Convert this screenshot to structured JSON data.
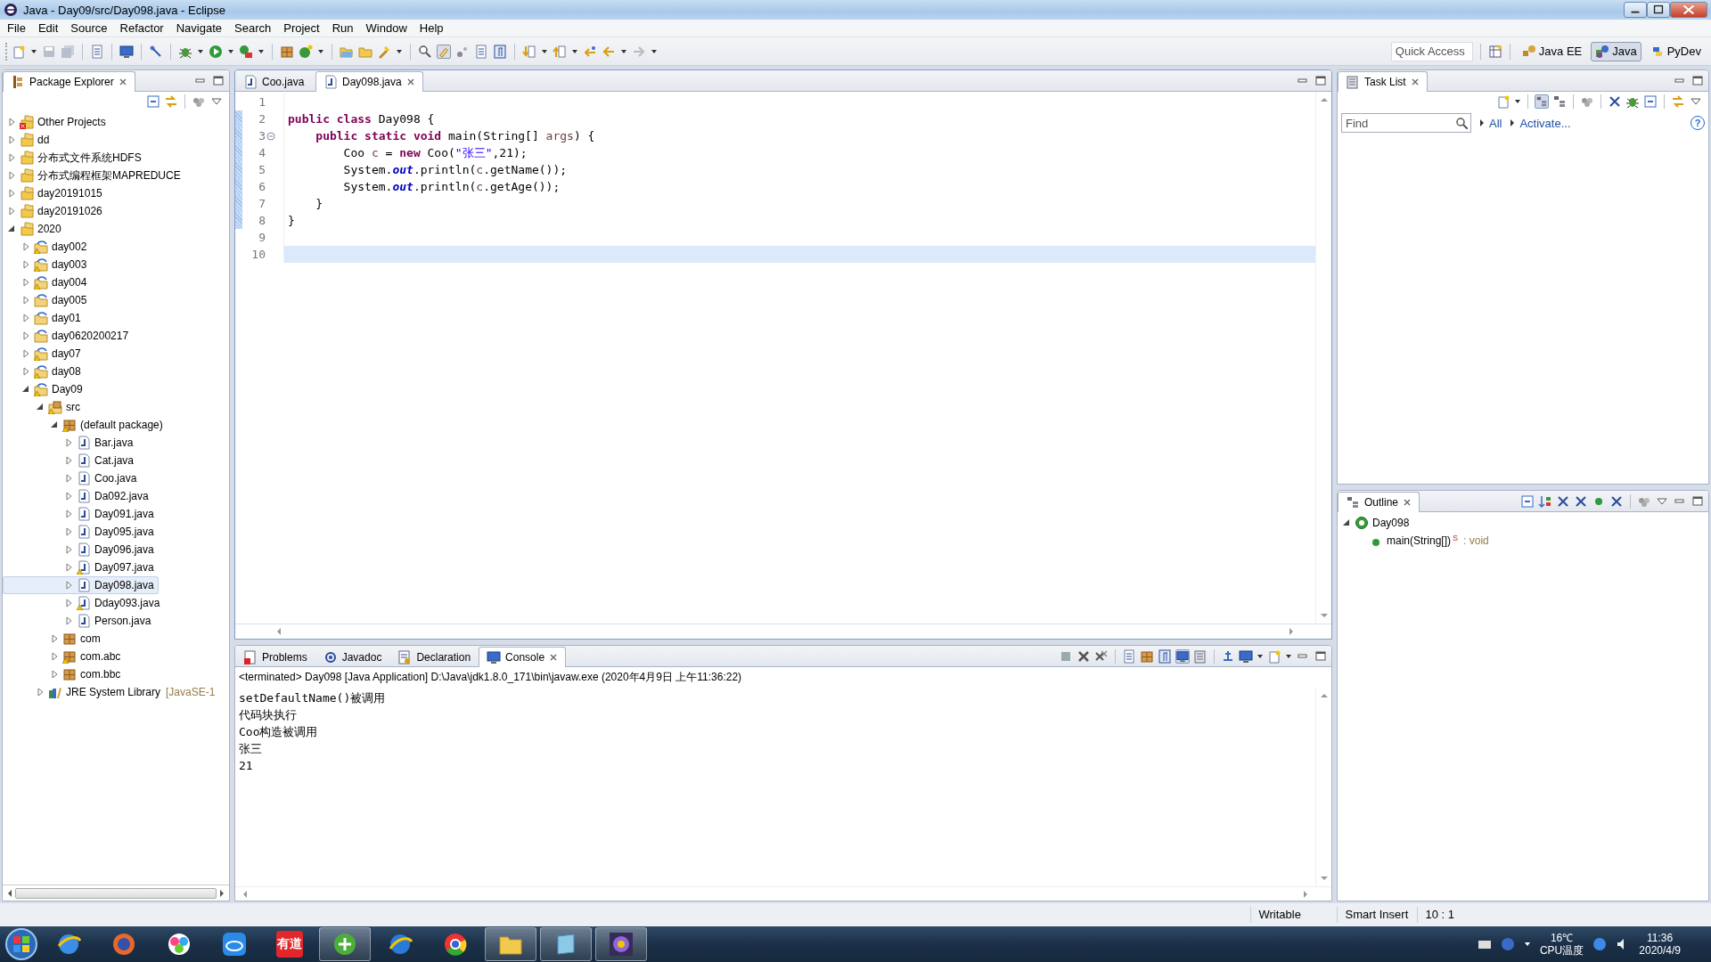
{
  "window": {
    "title": "Java - Day09/src/Day098.java - Eclipse"
  },
  "menu": [
    "File",
    "Edit",
    "Source",
    "Refactor",
    "Navigate",
    "Search",
    "Project",
    "Run",
    "Window",
    "Help"
  ],
  "quick_access": {
    "placeholder": "Quick Access"
  },
  "perspectives": [
    {
      "label": "Java EE",
      "selected": false
    },
    {
      "label": "Java",
      "selected": true
    },
    {
      "label": "PyDev",
      "selected": false
    }
  ],
  "package_explorer": {
    "title": "Package Explorer",
    "tree": [
      {
        "label": "Other Projects",
        "kind": "working-set",
        "error": true,
        "expanded": false,
        "selected": false
      },
      {
        "label": "dd",
        "kind": "working-set",
        "expanded": false,
        "selected": false
      },
      {
        "label": "分布式文件系统HDFS",
        "kind": "working-set",
        "expanded": false,
        "selected": false
      },
      {
        "label": "分布式编程框架MAPREDUCE",
        "kind": "working-set",
        "expanded": false,
        "selected": false
      },
      {
        "label": "day20191015",
        "kind": "working-set",
        "expanded": false,
        "selected": false
      },
      {
        "label": "day20191026",
        "kind": "working-set",
        "expanded": false,
        "selected": false
      },
      {
        "label": "2020",
        "kind": "working-set",
        "expanded": true,
        "selected": false,
        "children": [
          {
            "label": "day002",
            "kind": "project",
            "warning": true,
            "expanded": false,
            "selected": false
          },
          {
            "label": "day003",
            "kind": "project",
            "warning": true,
            "expanded": false,
            "selected": false
          },
          {
            "label": "day004",
            "kind": "project",
            "warning": true,
            "expanded": false,
            "selected": false
          },
          {
            "label": "day005",
            "kind": "project",
            "expanded": false,
            "selected": false
          },
          {
            "label": "day01",
            "kind": "project",
            "expanded": false,
            "selected": false
          },
          {
            "label": "day0620200217",
            "kind": "project",
            "expanded": false,
            "selected": false
          },
          {
            "label": "day07",
            "kind": "project",
            "warning": true,
            "expanded": false,
            "selected": false
          },
          {
            "label": "day08",
            "kind": "project",
            "warning": true,
            "expanded": false,
            "selected": false
          },
          {
            "label": "Day09",
            "kind": "project",
            "warning": true,
            "expanded": true,
            "selected": false,
            "children": [
              {
                "label": "src",
                "kind": "source-folder",
                "warning": true,
                "expanded": true,
                "selected": false,
                "children": [
                  {
                    "label": "(default package)",
                    "kind": "package",
                    "warning": true,
                    "expanded": true,
                    "selected": false,
                    "children": [
                      {
                        "label": "Bar.java",
                        "kind": "java-file",
                        "expanded": false,
                        "selected": false
                      },
                      {
                        "label": "Cat.java",
                        "kind": "java-file",
                        "expanded": false,
                        "selected": false
                      },
                      {
                        "label": "Coo.java",
                        "kind": "java-file",
                        "expanded": false,
                        "selected": false
                      },
                      {
                        "label": "Da092.java",
                        "kind": "java-file",
                        "expanded": false,
                        "selected": false
                      },
                      {
                        "label": "Day091.java",
                        "kind": "java-file",
                        "expanded": false,
                        "selected": false
                      },
                      {
                        "label": "Day095.java",
                        "kind": "java-file",
                        "expanded": false,
                        "selected": false
                      },
                      {
                        "label": "Day096.java",
                        "kind": "java-file",
                        "expanded": false,
                        "selected": false
                      },
                      {
                        "label": "Day097.java",
                        "kind": "java-file",
                        "warning": true,
                        "expanded": false,
                        "selected": false
                      },
                      {
                        "label": "Day098.java",
                        "kind": "java-file",
                        "expanded": false,
                        "selected": true
                      },
                      {
                        "label": "Dday093.java",
                        "kind": "java-file",
                        "warning": true,
                        "expanded": false,
                        "selected": false
                      },
                      {
                        "label": "Person.java",
                        "kind": "java-file",
                        "expanded": false,
                        "selected": false
                      }
                    ]
                  },
                  {
                    "label": "com",
                    "kind": "package",
                    "expanded": false,
                    "selected": false
                  },
                  {
                    "label": "com.abc",
                    "kind": "package",
                    "warning": true,
                    "expanded": false,
                    "selected": false
                  },
                  {
                    "label": "com.bbc",
                    "kind": "package",
                    "expanded": false,
                    "selected": false
                  }
                ]
              },
              {
                "label": "JRE System Library",
                "decoration": "[JavaSE-1",
                "kind": "library",
                "expanded": false,
                "selected": false
              }
            ]
          }
        ]
      }
    ]
  },
  "editor": {
    "tabs": [
      {
        "label": "Coo.java",
        "selected": false
      },
      {
        "label": "Day098.java",
        "selected": true
      }
    ],
    "lines": [
      {
        "number": "1",
        "marked": false,
        "fold_marker": false,
        "current": false
      },
      {
        "number": "2",
        "marked": true,
        "fold_marker": false,
        "current": false,
        "tokens": [
          {
            "kind": "keyword",
            "text": "public class"
          },
          {
            "kind": "plain",
            "text": " Day098 {"
          }
        ]
      },
      {
        "number": "3",
        "marked": true,
        "fold_marker": true,
        "current": false,
        "tokens": [
          {
            "kind": "keyword",
            "text": "    public static void"
          },
          {
            "kind": "plain",
            "text": " main(String[] "
          },
          {
            "kind": "local",
            "text": "args"
          },
          {
            "kind": "plain",
            "text": ") {"
          }
        ]
      },
      {
        "number": "4",
        "marked": true,
        "fold_marker": false,
        "current": false,
        "tokens": [
          {
            "kind": "plain",
            "text": "        Coo "
          },
          {
            "kind": "local",
            "text": "c"
          },
          {
            "kind": "plain",
            "text": " = "
          },
          {
            "kind": "keyword",
            "text": "new"
          },
          {
            "kind": "plain",
            "text": " Coo("
          },
          {
            "kind": "string",
            "text": "\"张三\""
          },
          {
            "kind": "plain",
            "text": ",21);"
          }
        ]
      },
      {
        "number": "5",
        "marked": true,
        "fold_marker": false,
        "current": false,
        "tokens": [
          {
            "kind": "plain",
            "text": "        System."
          },
          {
            "kind": "field",
            "text": "out"
          },
          {
            "kind": "plain",
            "text": ".println("
          },
          {
            "kind": "local",
            "text": "c"
          },
          {
            "kind": "plain",
            "text": ".getName());"
          }
        ]
      },
      {
        "number": "6",
        "marked": true,
        "fold_marker": false,
        "current": false,
        "tokens": [
          {
            "kind": "plain",
            "text": "        System."
          },
          {
            "kind": "field",
            "text": "out"
          },
          {
            "kind": "plain",
            "text": ".println("
          },
          {
            "kind": "local",
            "text": "c"
          },
          {
            "kind": "plain",
            "text": ".getAge());"
          }
        ]
      },
      {
        "number": "7",
        "marked": true,
        "fold_marker": false,
        "current": false,
        "tokens": [
          {
            "kind": "plain",
            "text": "    }"
          }
        ]
      },
      {
        "number": "8",
        "marked": true,
        "fold_marker": false,
        "current": false,
        "tokens": [
          {
            "kind": "plain",
            "text": "}"
          }
        ]
      },
      {
        "number": "9",
        "marked": false,
        "fold_marker": false,
        "current": false
      },
      {
        "number": "10",
        "marked": false,
        "fold_marker": false,
        "current": true
      }
    ]
  },
  "console": {
    "tabs": [
      {
        "label": "Problems",
        "selected": false
      },
      {
        "label": "Javadoc",
        "selected": false
      },
      {
        "label": "Declaration",
        "selected": false
      },
      {
        "label": "Console",
        "selected": true
      }
    ],
    "header": "<terminated> Day098 [Java Application] D:\\Java\\jdk1.8.0_171\\bin\\javaw.exe (2020年4月9日 上午11:36:22)",
    "output": [
      "setDefaultName()被调用",
      "代码块执行",
      "Coo构造被调用",
      "张三",
      "21"
    ]
  },
  "task_list": {
    "title": "Task List",
    "find": {
      "placeholder": "Find"
    },
    "links": [
      "All",
      "Activate..."
    ],
    "help": "?"
  },
  "outline": {
    "title": "Outline",
    "tree": [
      {
        "label": "Day098",
        "kind": "class",
        "expanded": true,
        "selected": false,
        "children": [
          {
            "label": "main(String[])",
            "modifier": "S",
            "type": " : void",
            "kind": "method",
            "selected": false
          }
        ]
      }
    ]
  },
  "status_bar": [
    "Writable",
    "Smart Insert",
    "10 : 1"
  ],
  "taskbar": {
    "app_label": "有道",
    "temperature": "16℃",
    "sensor": "CPU温度",
    "time": "11:36",
    "date": "2020/4/9"
  }
}
